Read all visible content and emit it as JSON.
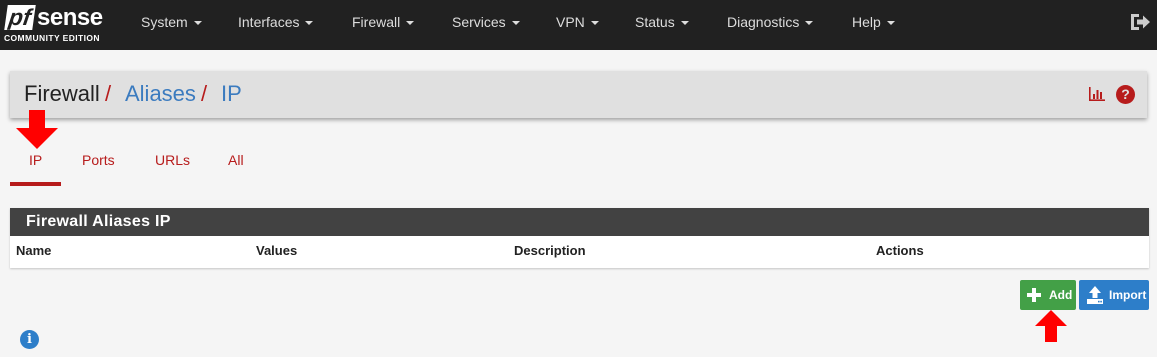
{
  "brand": {
    "logo_pf": "pf",
    "logo_sense": "sense",
    "edition": "COMMUNITY EDITION"
  },
  "nav": {
    "items": [
      "System",
      "Interfaces",
      "Firewall",
      "Services",
      "VPN",
      "Status",
      "Diagnostics",
      "Help"
    ],
    "logout_icon": "sign-out-icon"
  },
  "breadcrumb": {
    "root": "Firewall",
    "separator": "/",
    "level1": "Aliases",
    "level2": "IP"
  },
  "header_icons": [
    "bar-chart-icon",
    "question-circle-icon"
  ],
  "tabs": [
    {
      "label": "IP",
      "active": true
    },
    {
      "label": "Ports",
      "active": false
    },
    {
      "label": "URLs",
      "active": false
    },
    {
      "label": "All",
      "active": false
    }
  ],
  "panel": {
    "title": "Firewall Aliases IP",
    "columns": [
      "Name",
      "Values",
      "Description",
      "Actions"
    ],
    "rows": []
  },
  "buttons": {
    "add": "Add",
    "import": "Import"
  },
  "info_icon": "info-circle-icon",
  "colors": {
    "navbar": "#212121",
    "accent_red": "#b71c1c",
    "link_blue": "#3b7bbf",
    "add_green": "#43a047",
    "import_blue": "#2d7ec9",
    "panel_heading": "#424242",
    "annotation_arrow": "#ff0000"
  }
}
